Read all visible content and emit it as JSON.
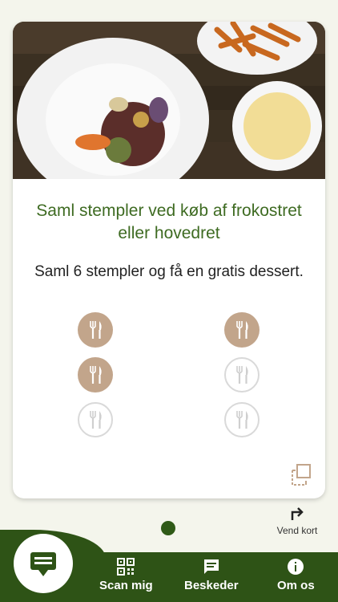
{
  "card": {
    "title": "Saml stempler ved køb af frokostret eller hovedret",
    "subtitle": "Saml 6 stempler og få en gratis dessert.",
    "stamps_total": 6,
    "stamps_collected": 3,
    "stamps": [
      {
        "filled": true,
        "icon": "fork-knife-icon"
      },
      {
        "filled": true,
        "icon": "fork-knife-icon"
      },
      {
        "filled": true,
        "icon": "fork-knife-icon"
      },
      {
        "filled": false,
        "icon": "fork-knife-icon"
      },
      {
        "filled": false,
        "icon": "fork-knife-icon"
      },
      {
        "filled": false,
        "icon": "fork-knife-icon"
      }
    ]
  },
  "flip": {
    "label": "Vend kort",
    "icon": "flip-arrow-icon"
  },
  "pager": {
    "current": 1,
    "total": 1
  },
  "nav": {
    "home_icon": "loyalty-card-icon",
    "items": [
      {
        "label": "Scan mig",
        "icon": "qr-code-icon"
      },
      {
        "label": "Beskeder",
        "icon": "message-icon"
      },
      {
        "label": "Om os",
        "icon": "info-icon"
      }
    ]
  },
  "colors": {
    "accent_green": "#3e6b22",
    "nav_green": "#2e5316",
    "stamp_filled": "#c2a58b",
    "background": "#f4f5ec"
  }
}
